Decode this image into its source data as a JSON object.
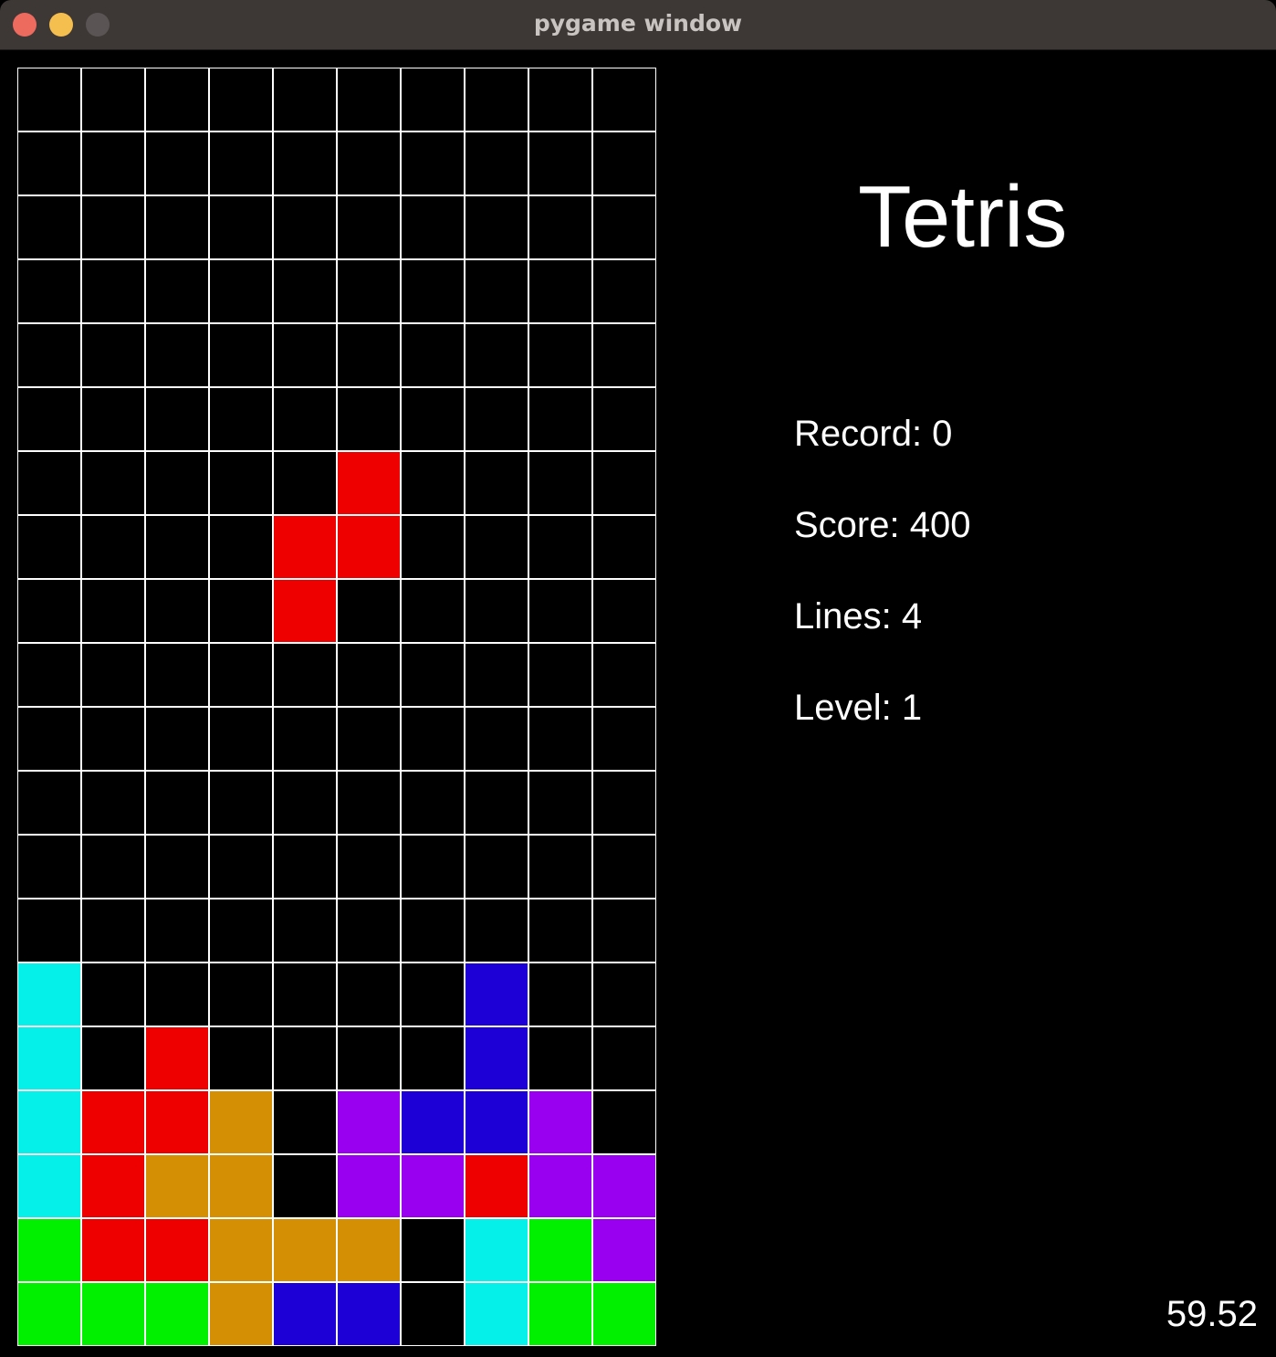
{
  "window": {
    "title": "pygame window"
  },
  "game": {
    "title": "Tetris",
    "stats": {
      "record": "Record: 0",
      "score": "Score: 400",
      "lines": "Lines: 4",
      "level": "Level: 1"
    },
    "fps": "59.52"
  },
  "colors": {
    "grid_line": "#ffffff",
    "empty": "#000000",
    "C": "#04f0e8",
    "R": "#ef0000",
    "O": "#d48f04",
    "P": "#9900f0",
    "B": "#1c00d6",
    "G": "#00f000"
  },
  "board": {
    "columns": 10,
    "rows": 20,
    "cells": [
      "..........",
      "..........",
      "..........",
      "..........",
      "..........",
      "..........",
      ".....R....",
      "....RR....",
      "....R.....",
      "..........",
      "..........",
      "..........",
      "..........",
      "..........",
      "C......B..",
      "C.R....B..",
      "CRRO.PBBP.",
      "CROO.PPRPP",
      "GRROOO.CGP",
      "GGGOBB.CGG"
    ]
  }
}
